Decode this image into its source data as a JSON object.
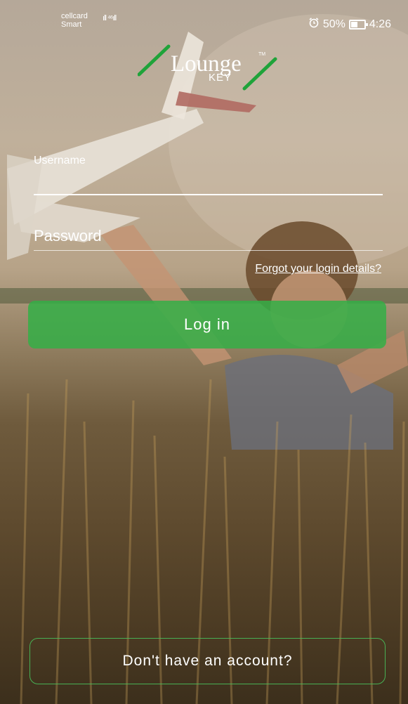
{
  "status_bar": {
    "carrier_line1": "cellcard",
    "carrier_line2": "Smart",
    "signal_text": "ıll ⁴⁶ıll",
    "alarm_icon": "alarm-clock-icon",
    "battery_percent": "50%",
    "time": "4:26"
  },
  "logo": {
    "name": "Lounge",
    "sub": "KEY",
    "tm": "TM",
    "accent_color": "#1fa33a"
  },
  "form": {
    "username_label": "Username",
    "password_label": "Password",
    "forgot_link": "Forgot your login details?",
    "login_button": "Log in"
  },
  "footer": {
    "signup_button": "Don't have an account?"
  },
  "colors": {
    "primary_green": "#34af46",
    "text": "#ffffff"
  }
}
